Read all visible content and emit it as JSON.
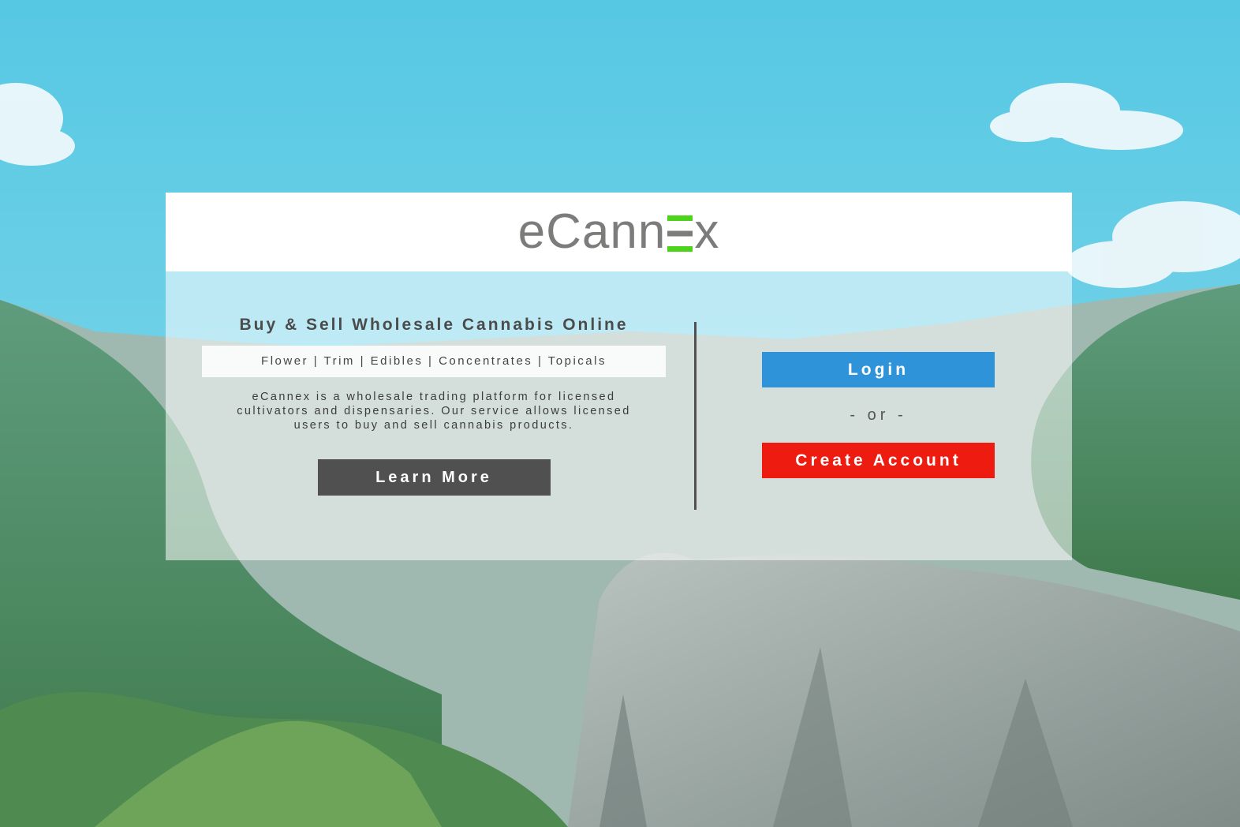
{
  "brand": {
    "logo_text_before": "eCann",
    "logo_text_after": "x",
    "logo_gray": "#7c7d7b",
    "logo_green": "#4cd41a"
  },
  "hero": {
    "tagline": "Buy & Sell Wholesale Cannabis Online",
    "categories": "Flower | Trim | Edibles | Concentrates | Topicals",
    "description_line1": "eCannex is a wholesale trading platform for licensed",
    "description_line2": "cultivators and dispensaries. Our service allows licensed",
    "description_line3": "users to buy and sell cannabis products.",
    "learn_more_label": "Learn More"
  },
  "auth": {
    "login_label": "Login",
    "or_label": "- or -",
    "create_account_label": "Create Account"
  },
  "colors": {
    "login": "#2f93d9",
    "create_account": "#ee1c10",
    "learn_more": "#505050"
  }
}
